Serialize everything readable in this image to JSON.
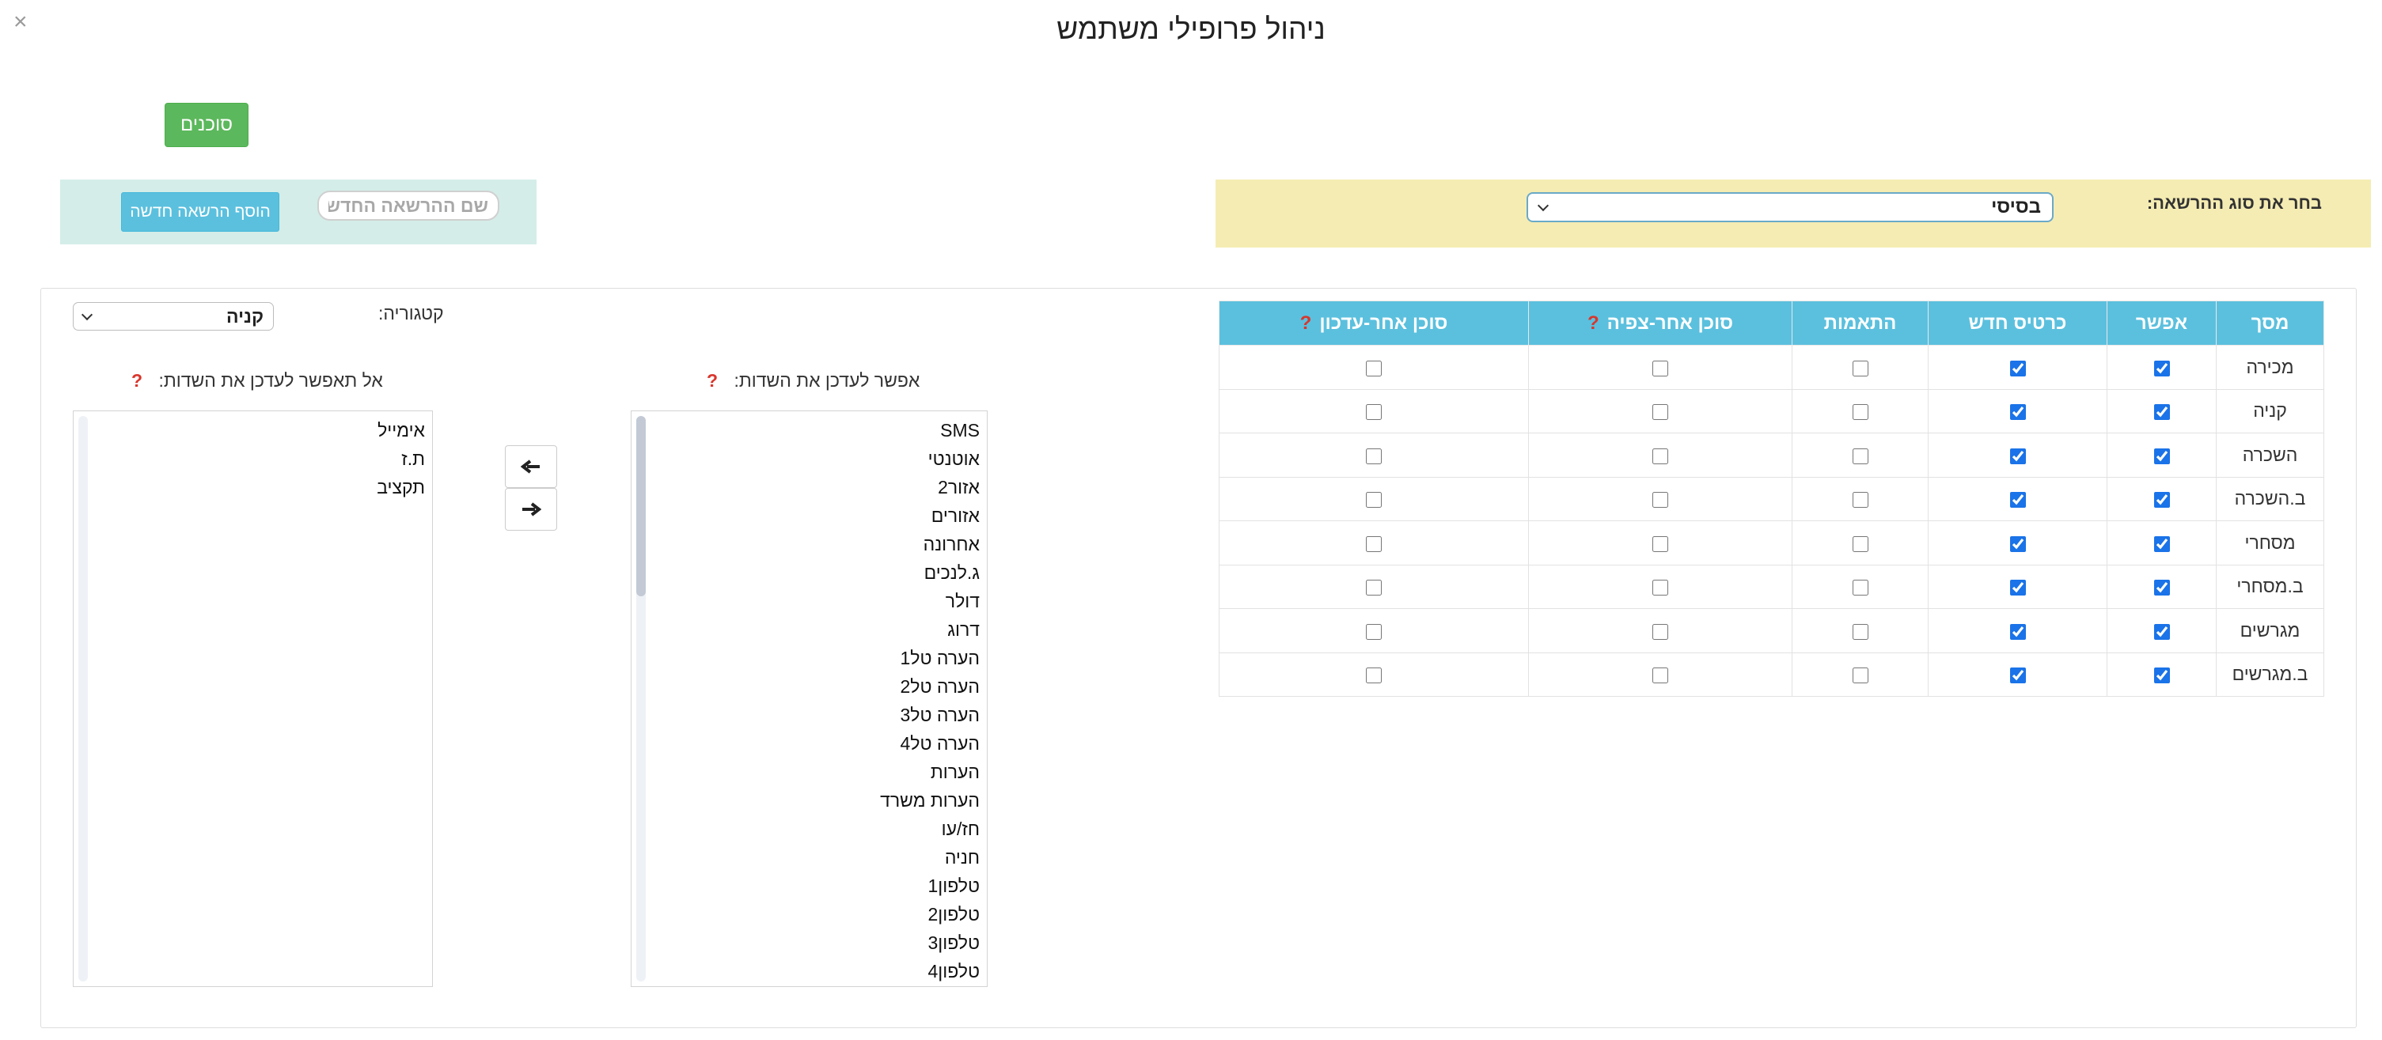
{
  "dialog": {
    "title": "ניהול פרופילי משתמש",
    "close_glyph": "×"
  },
  "agents_button": {
    "label": "סוכנים",
    "color": "#5cb85c"
  },
  "new_permission": {
    "add_button_label": "הוסף הרשאה חדשה",
    "name_placeholder": "שם ההרשאה החדשה",
    "panel_color": "#d4ede8"
  },
  "permission_type": {
    "label": "בחר את סוג ההרשאה:",
    "selected": "בסיסי",
    "panel_color": "#f5ecb3"
  },
  "table": {
    "header_color": "#5bc0de",
    "columns": [
      "מסך",
      "אפשר",
      "כרטיס חדש",
      "התאמות",
      "סוכן אחר-צפיה",
      "סוכן אחר-עדכון"
    ],
    "help_columns": [
      4,
      5
    ],
    "help_glyph": "?",
    "rows": [
      {
        "screen": "מכירה",
        "allow": true,
        "new_card": true,
        "matches": false,
        "other_view": false,
        "other_update": false
      },
      {
        "screen": "קניה",
        "allow": true,
        "new_card": true,
        "matches": false,
        "other_view": false,
        "other_update": false
      },
      {
        "screen": "השכרה",
        "allow": true,
        "new_card": true,
        "matches": false,
        "other_view": false,
        "other_update": false
      },
      {
        "screen": "ב.השכרה",
        "allow": true,
        "new_card": true,
        "matches": false,
        "other_view": false,
        "other_update": false
      },
      {
        "screen": "מסחרי",
        "allow": true,
        "new_card": true,
        "matches": false,
        "other_view": false,
        "other_update": false
      },
      {
        "screen": "ב.מסחרי",
        "allow": true,
        "new_card": true,
        "matches": false,
        "other_view": false,
        "other_update": false
      },
      {
        "screen": "מגרשים",
        "allow": true,
        "new_card": true,
        "matches": false,
        "other_view": false,
        "other_update": false
      },
      {
        "screen": "ב.מגרשים",
        "allow": true,
        "new_card": true,
        "matches": false,
        "other_view": false,
        "other_update": false
      }
    ]
  },
  "category": {
    "label": "קטגוריה:",
    "selected": "קניה"
  },
  "fields": {
    "allowed_heading": "אפשר לעדכן את השדות:",
    "disallowed_heading": "אל תאפשר לעדכן את השדות:",
    "help_glyph": "?",
    "allowed": [
      "SMS",
      "אוטנטי",
      "אזור2",
      "אזורים",
      "אחרונה",
      "ג.לנכים",
      "דולר",
      "דרוג",
      "הערה טל1",
      "הערה טל2",
      "הערה טל3",
      "הערה טל4",
      "הערות",
      "הערות משרד",
      "חז/עו",
      "חניה",
      "טלפון1",
      "טלפון2",
      "טלפון3",
      "טלפון4"
    ],
    "disallowed": [
      "אימייל",
      "ת.ז",
      "תקציב"
    ],
    "move_left_icon": "arrow-left-icon",
    "move_right_icon": "arrow-right-icon"
  }
}
